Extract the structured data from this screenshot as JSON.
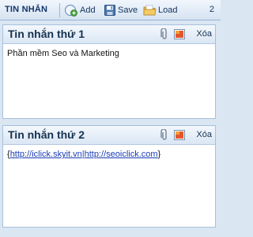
{
  "toolbar": {
    "title": "TIN NHẮN",
    "add_label": "Add",
    "save_label": "Save",
    "load_label": "Load",
    "count": "2"
  },
  "notes": [
    {
      "title": "Tin nhắn thứ 1",
      "delete_label": "Xóa",
      "content": "Phần mềm Seo và Marketing"
    },
    {
      "title": "Tin nhắn thứ 2",
      "delete_label": "Xóa",
      "content_open": "{",
      "link1": "http://iclick.skyit.vn",
      "separator": "|",
      "link2": "http://seoiclick.com",
      "content_close": "}"
    }
  ],
  "icons": {
    "add": "add-icon",
    "save": "save-icon",
    "load": "folder-icon",
    "attach": "paperclip-icon",
    "color": "color-picker-icon"
  },
  "colors": {
    "background": "#dbe6f3",
    "title_text": "#16324f",
    "link": "#1a3cb5"
  }
}
